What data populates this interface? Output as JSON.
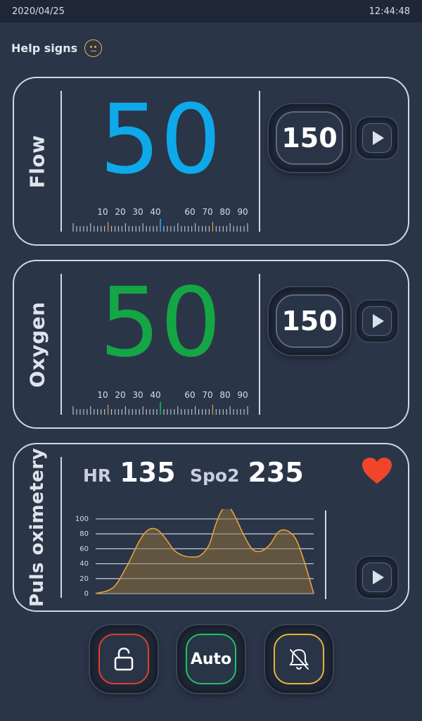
{
  "status_bar": {
    "date": "2020/04/25",
    "time": "12:44:48"
  },
  "help": {
    "label": "Help signs",
    "icon": "neutral-face-icon"
  },
  "flow": {
    "label": "Flow",
    "value": "50",
    "value_color": "#0ea9ea",
    "setpoint": "150",
    "scale_labels": [
      "10",
      "20",
      "30",
      "40",
      "60",
      "70",
      "80",
      "90"
    ],
    "marker_color": "#2d8ecf",
    "limit_color": "#e8a13a"
  },
  "oxygen": {
    "label": "Oxygen",
    "value": "50",
    "value_color": "#14a645",
    "setpoint": "150",
    "scale_labels": [
      "10",
      "20",
      "30",
      "40",
      "60",
      "70",
      "80",
      "90"
    ],
    "marker_color": "#14a645",
    "limit_color": "#e8a13a"
  },
  "pulse": {
    "label": "Puls oximetery",
    "hr_label": "HR",
    "hr_value": "135",
    "spo2_label": "Spo2",
    "spo2_value": "235",
    "heart_icon": "heart-icon",
    "heart_color": "#f0452b"
  },
  "chart_data": {
    "type": "area",
    "y_ticks": [
      "0",
      "20",
      "40",
      "60",
      "80",
      "100"
    ],
    "ylim": [
      0,
      100
    ],
    "xlim": [
      0,
      100
    ],
    "grid": true,
    "line_color": "#e8a13a",
    "fill_color": "#6b5a3e",
    "x": [
      0,
      8,
      14,
      20,
      24,
      28,
      32,
      36,
      40,
      44,
      48,
      52,
      55,
      58,
      61,
      64,
      68,
      72,
      76,
      80,
      84,
      88,
      92,
      96,
      100
    ],
    "y": [
      0,
      8,
      35,
      70,
      85,
      86,
      74,
      58,
      51,
      49,
      51,
      65,
      92,
      112,
      116,
      103,
      78,
      59,
      57,
      66,
      83,
      84,
      72,
      40,
      0
    ]
  },
  "controls": {
    "lock_icon": "unlock-icon",
    "lock_color": "#e0402c",
    "auto_label": "Auto",
    "auto_color": "#1fc266",
    "bell_icon": "bell-off-icon",
    "bell_color": "#e8b43a"
  }
}
